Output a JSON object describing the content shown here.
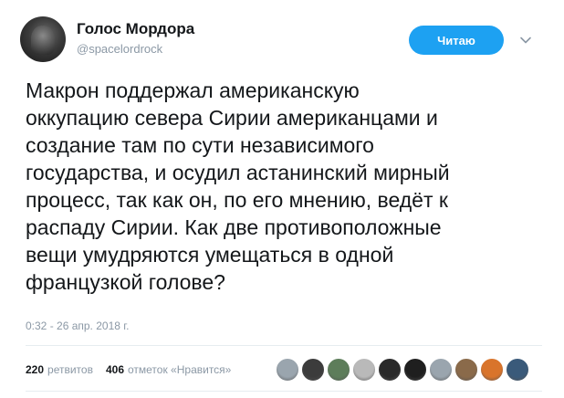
{
  "header": {
    "display_name": "Голос Мордора",
    "handle": "@spacelordrock",
    "follow_label": "Читаю",
    "follow_color": "#1da1f2"
  },
  "tweet": {
    "text": "Макрон поддержал американскую\nоккупацию севера Сирии американцами и\nсоздание там по сути независимого\nгосударства, и осудил астанинский мирный\nпроцесс, так как он, по его мнению, ведёт к\nраспаду Сирии. Как две противоположные\nвещи умудряются умещаться в одной\nфранцузкой голове?",
    "timestamp": "0:32 - 26 апр. 2018 г."
  },
  "stats": {
    "retweets_count": "220",
    "retweets_label": "ретвитов",
    "likes_count": "406",
    "likes_label": "отметок «Нравится»"
  },
  "likers": [
    {
      "icon": "avatar-gray",
      "color": "#9aa5ae"
    },
    {
      "icon": "avatar-person-dark",
      "color": "#3c3c3c"
    },
    {
      "icon": "avatar-green",
      "color": "#5d7d5a"
    },
    {
      "icon": "avatar-figure",
      "color": "#b9b9b9"
    },
    {
      "icon": "avatar-dark",
      "color": "#2a2a2a"
    },
    {
      "icon": "avatar-dark-2",
      "color": "#1f1f1f"
    },
    {
      "icon": "avatar-gray-2",
      "color": "#9aa5ae"
    },
    {
      "icon": "avatar-brown",
      "color": "#8a6a4a"
    },
    {
      "icon": "avatar-orange",
      "color": "#d9742b"
    },
    {
      "icon": "avatar-blue",
      "color": "#3a5a7a"
    }
  ]
}
